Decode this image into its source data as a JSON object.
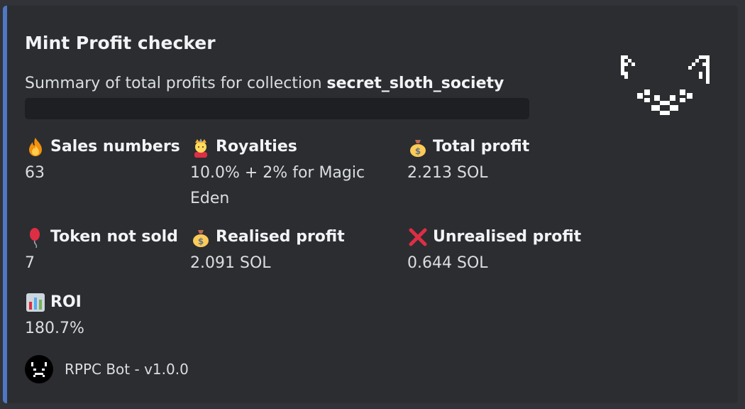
{
  "embed": {
    "accent_color": "#4e78c2",
    "title": "Mint Profit checker",
    "description_prefix": "Summary of total profits for collection ",
    "collection": "secret_sloth_society",
    "thumbnail_icon": "pixel-cat-face-icon",
    "fields": [
      {
        "icon": "fire-icon",
        "name": "Sales numbers",
        "value": "63"
      },
      {
        "icon": "crowned-person-icon",
        "name": "Royalties",
        "value": "10.0% + 2% for Magic Eden"
      },
      {
        "icon": "money-bag-icon",
        "name": "Total profit",
        "value": "2.213 SOL"
      },
      {
        "icon": "balloon-icon",
        "name": "Token not sold",
        "value": "7"
      },
      {
        "icon": "money-bag-icon",
        "name": "Realised profit",
        "value": "2.091 SOL"
      },
      {
        "icon": "cross-mark-icon",
        "name": "Unrealised profit",
        "value": "0.644 SOL"
      },
      {
        "icon": "bar-chart-icon",
        "name": "ROI",
        "value": "180.7%"
      }
    ],
    "footer": {
      "avatar_icon": "bot-avatar-icon",
      "text": "RPPC Bot - v1.0.0"
    }
  }
}
